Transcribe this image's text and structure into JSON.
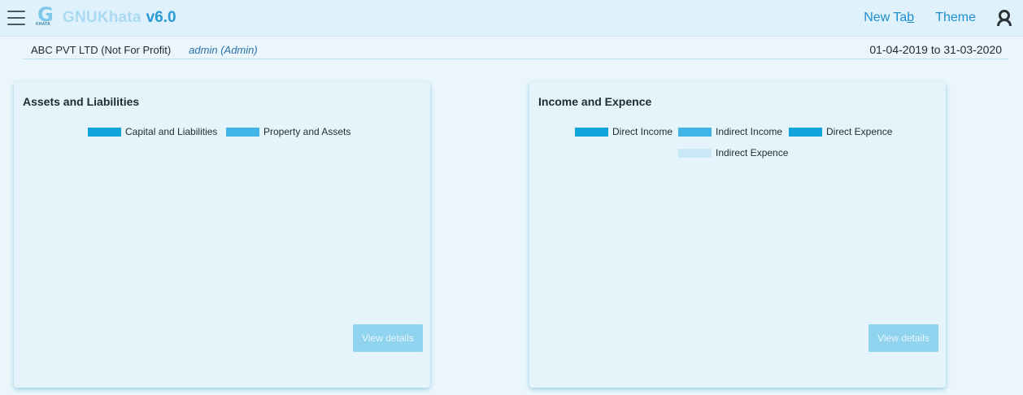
{
  "navbar": {
    "logo_sub": "KHATA",
    "brand": "GNUKhata",
    "version": "v6.0",
    "new_tab_prefix": "New Ta",
    "new_tab_underlined": "b",
    "theme": "Theme"
  },
  "subbar": {
    "organisation": "ABC PVT LTD (Not For Profit)",
    "user": "admin (Admin)",
    "period": "01-04-2019 to 31-03-2020"
  },
  "assets_card": {
    "title": "Assets and Liabilities",
    "legend": [
      {
        "label": "Capital and Liabilities",
        "color": "#10a4dd"
      },
      {
        "label": "Property and Assets",
        "color": "#41b6e6"
      }
    ],
    "button": "View details"
  },
  "income_card": {
    "title": "Income and Expence",
    "legend": [
      {
        "label": "Direct Income",
        "color": "#10a4dd"
      },
      {
        "label": "Indirect Income",
        "color": "#41b6e6"
      },
      {
        "label": "Direct Expence",
        "color": "#10a4dd"
      },
      {
        "label": "Indirect Expence",
        "color": "#c8e8f6"
      }
    ],
    "button": "View details"
  }
}
